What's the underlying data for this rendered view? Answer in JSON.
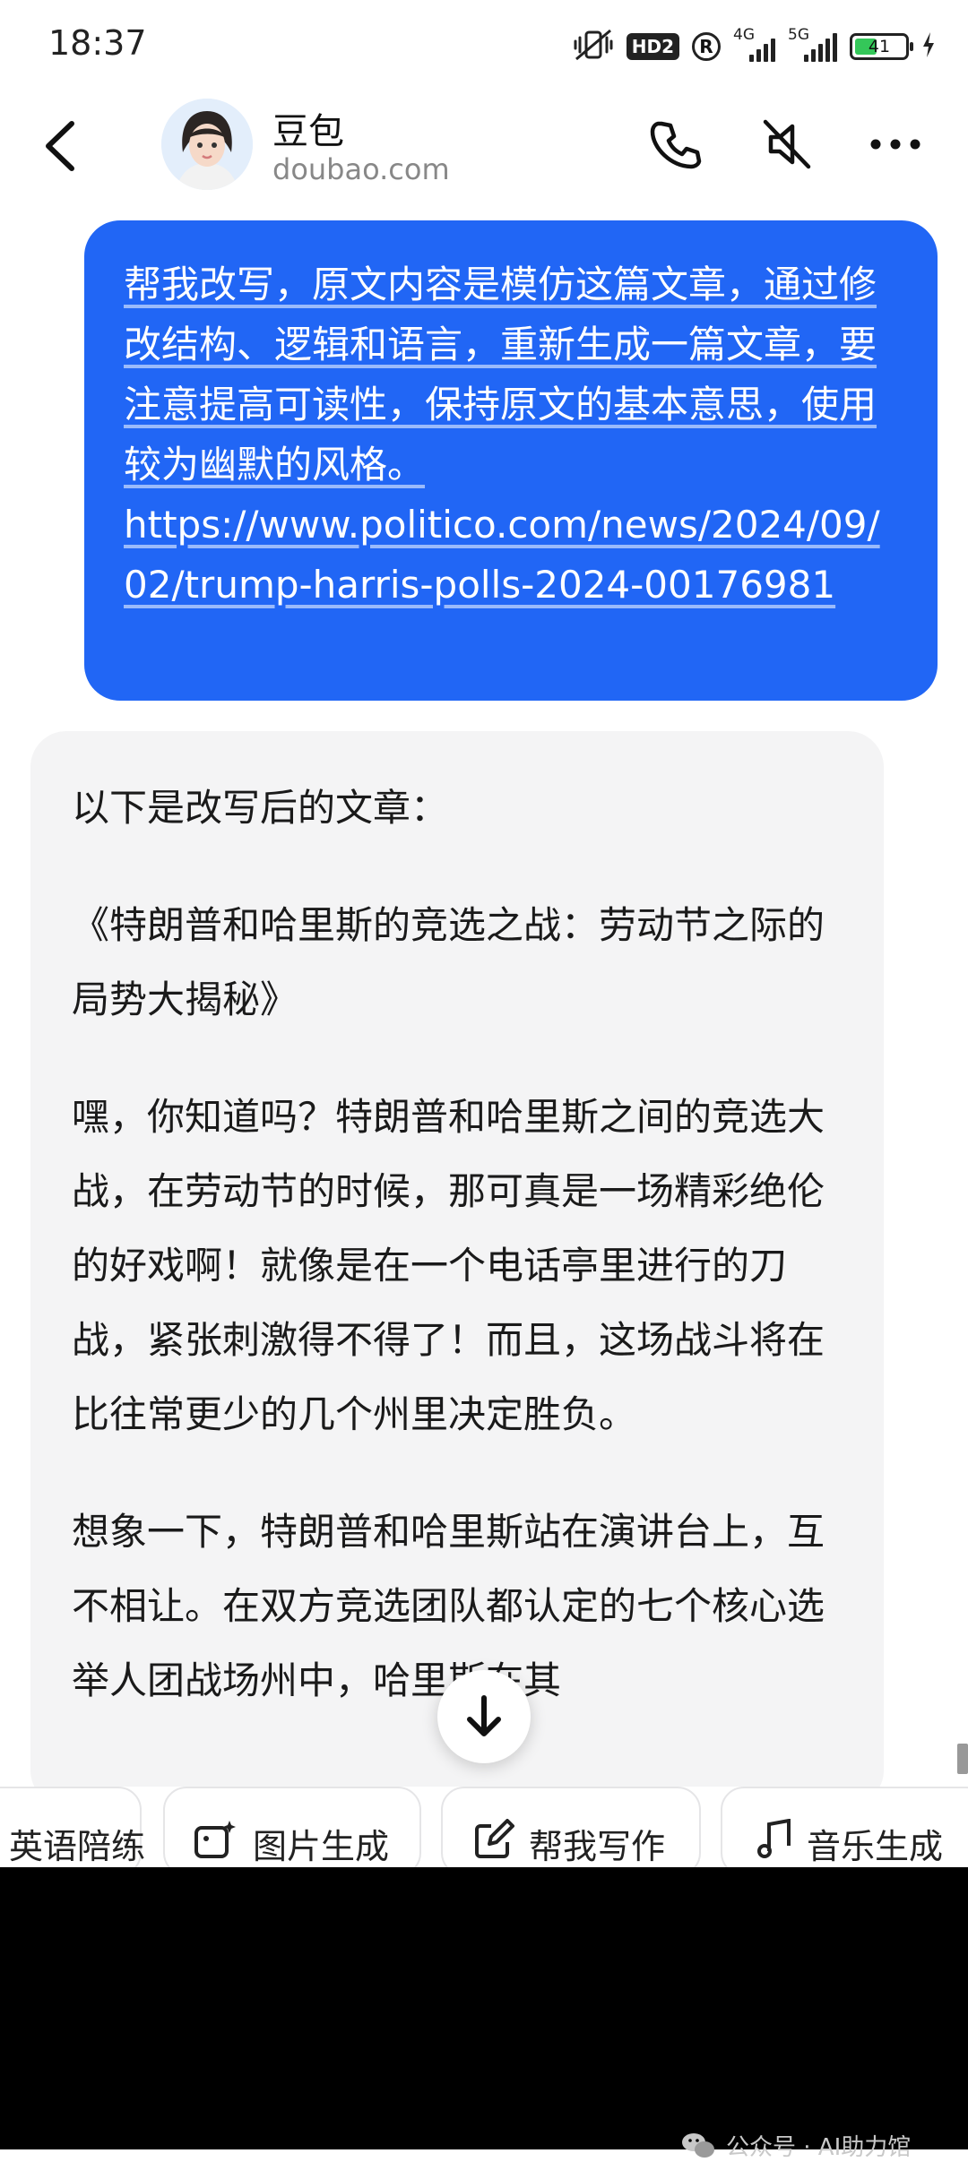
{
  "status_bar": {
    "time": "18:37",
    "hd_badge": "HD2",
    "r_badge": "R",
    "net1": "4G",
    "net2": "5G",
    "battery_level": "41"
  },
  "header": {
    "name": "豆包",
    "url": "doubao.com"
  },
  "user_message": {
    "lines": [
      "帮我改写，原文内容是模仿这篇文章，通过修改结构、逻辑和语言，重新生成一篇文章，要注意提高可读性，保持原文的基本意思，使用较为幽默的风格。",
      "https://www.politico.com/news/2024/09/02/trump-harris-polls-2024-00176981"
    ]
  },
  "bot_message": {
    "paragraphs": [
      "以下是改写后的文章：",
      "《特朗普和哈里斯的竞选之战：劳动节之际的局势大揭秘》",
      "嘿，你知道吗？特朗普和哈里斯之间的竞选大战，在劳动节的时候，那可真是一场精彩绝伦的好戏啊！就像是在一个电话亭里进行的刀战，紧张刺激得不得了！而且，这场战斗将在比往常更少的几个州里决定胜负。",
      "想象一下，特朗普和哈里斯站在演讲台上，互不相让。在双方竞选团队都认定的七个核心选举人团战场州中，哈里斯在其"
    ]
  },
  "quick_actions": [
    {
      "label": "英语陪练",
      "icon": "language-icon"
    },
    {
      "label": "图片生成",
      "icon": "image-sparkle-icon"
    },
    {
      "label": "帮我写作",
      "icon": "pen-write-icon"
    },
    {
      "label": "音乐生成",
      "icon": "music-note-icon"
    }
  ],
  "watermark": "公众号 · AI助力馆",
  "colors": {
    "user_bubble": "#2166f5",
    "bot_bubble": "#f4f4f5",
    "battery_fill": "#34c759"
  }
}
